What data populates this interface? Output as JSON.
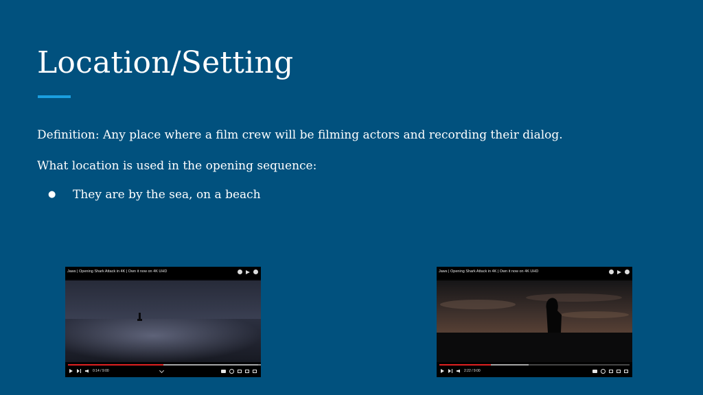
{
  "slide": {
    "title": "Location/Setting",
    "definition": "Definition:  Any place where a film crew will be filming actors and recording their dialog.",
    "question": "What location is used in the opening sequence:",
    "bullets": [
      "They are by the sea, on a beach"
    ]
  },
  "videos": [
    {
      "title": "Jaws | Opening Shark Attack in 4K | Own it now on 4K UHD",
      "time": "0:14 / 9:00",
      "progress": 0.5,
      "buffered": 0.52
    },
    {
      "title": "Jaws | Opening Shark Attack in 4K | Own it now on 4K UHD",
      "time": "2:22 / 9:00",
      "progress": 0.27,
      "buffered": 0.2
    }
  ],
  "colors": {
    "background": "#01517e",
    "accent": "#1a9fe0",
    "text": "#ffffff",
    "progress": "#e02020"
  },
  "icons": [
    "clock-icon",
    "share-icon",
    "info-icon",
    "play-icon",
    "next-icon",
    "volume-icon",
    "settings-icon",
    "fullscreen-icon"
  ]
}
